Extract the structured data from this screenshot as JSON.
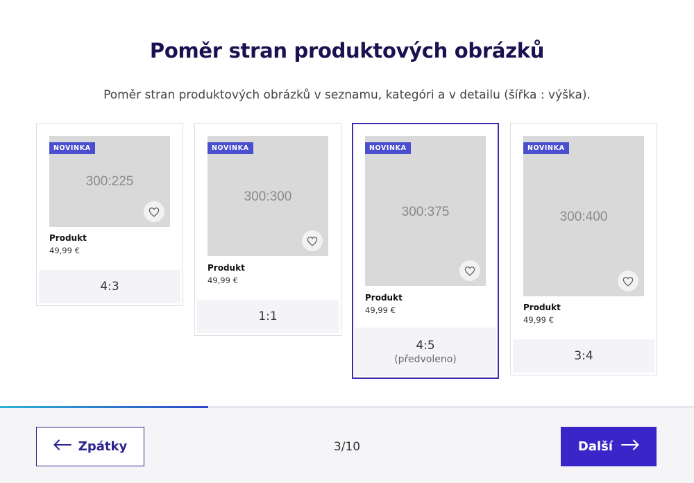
{
  "header": {
    "title": "Poměr stran produktových obrázků",
    "subtitle": "Poměr stran produktových obrázků v seznamu, kategóri a v detailu (šířka : výška)."
  },
  "options": [
    {
      "badge": "NOVINKA",
      "image_text": "300:225",
      "product_name": "Produkt",
      "price": "49,99 €",
      "ratio": "4:3",
      "note": "",
      "selected": false
    },
    {
      "badge": "NOVINKA",
      "image_text": "300:300",
      "product_name": "Produkt",
      "price": "49,99 €",
      "ratio": "1:1",
      "note": "",
      "selected": false
    },
    {
      "badge": "NOVINKA",
      "image_text": "300:375",
      "product_name": "Produkt",
      "price": "49,99 €",
      "ratio": "4:5",
      "note": "(předvoleno)",
      "selected": true
    },
    {
      "badge": "NOVINKA",
      "image_text": "300:400",
      "product_name": "Produkt",
      "price": "49,99 €",
      "ratio": "3:4",
      "note": "",
      "selected": false
    }
  ],
  "progress": {
    "current": 3,
    "total": 10,
    "fraction": 0.3
  },
  "footer": {
    "back_label": "Zpátky",
    "next_label": "Další",
    "step_text": "3/10"
  },
  "colors": {
    "title": "#1a1150",
    "accent": "#3a25c8",
    "badge": "#4a4fd0",
    "selected_border": "#3b2db0"
  },
  "icons": {
    "back": "arrow-left-icon",
    "next": "arrow-right-icon",
    "favorite": "heart-icon"
  }
}
